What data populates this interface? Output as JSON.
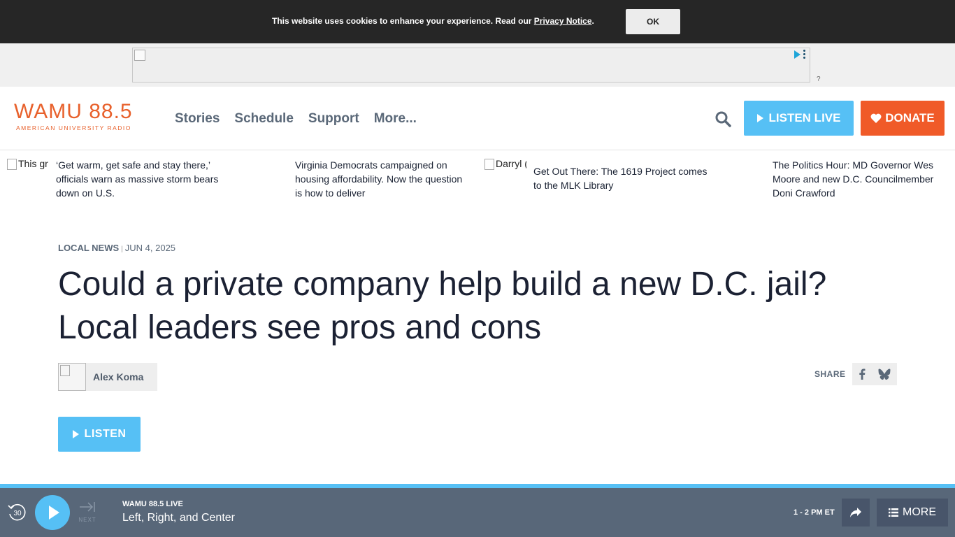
{
  "cookie": {
    "text": "This website uses cookies to enhance your experience. Read our ",
    "link": "Privacy Notice",
    "suffix": ".",
    "ok": "OK"
  },
  "ad": {
    "question": "?"
  },
  "header": {
    "logo_main": "WAMU 88.5",
    "logo_sub": "AMERICAN UNIVERSITY RADIO",
    "nav": [
      "Stories",
      "Schedule",
      "Support",
      "More..."
    ],
    "listen_live": "LISTEN LIVE",
    "donate": "DONATE"
  },
  "stories": [
    {
      "img_alt": "This gr",
      "title": "‘Get warm, get safe and stay there,’ officials warn as massive storm bears down on U.S."
    },
    {
      "img_alt": "",
      "title": "Virginia Democrats campaigned on housing affordability. Now the question is how to deliver"
    },
    {
      "img_alt": "Darryl (",
      "title": "Get Out There: The 1619 Project comes to the MLK Library"
    },
    {
      "img_alt": "",
      "title": "The Politics Hour: MD Governor Wes Moore and new D.C. Councilmember Doni Crawford"
    }
  ],
  "article": {
    "category": "LOCAL NEWS",
    "separator": "|",
    "date": "JUN 4, 2025",
    "headline": "Could a private company help build a new D.C. jail? Local leaders see pros and cons",
    "author": "Alex Koma",
    "share_label": "SHARE",
    "listen": "LISTEN"
  },
  "player": {
    "rewind": "30",
    "next": "NEXT",
    "station": "WAMU 88.5 LIVE",
    "show": "Left, Right, and Center",
    "time": "1 - 2 PM ET",
    "more": "MORE"
  },
  "colors": {
    "accent_blue": "#56c0f5",
    "brand_orange": "#e8612c",
    "donate_orange": "#f05a28",
    "player_bg": "#586779"
  }
}
